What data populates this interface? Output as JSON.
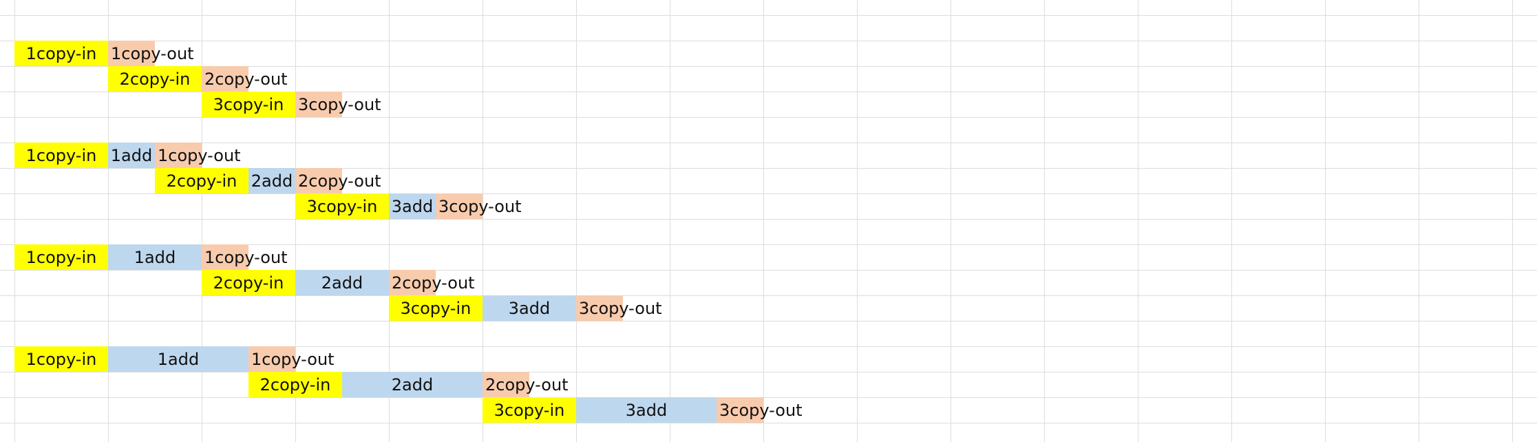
{
  "colors": {
    "copy_in": "#ffff00",
    "add": "#bdd7ee",
    "copy_out": "#f8cbad",
    "gridline": "#dcdcdc"
  },
  "groups": [
    {
      "rows": [
        [
          {
            "label": "1copy-in",
            "kind": "copy_in",
            "start": 0,
            "span": 2
          },
          {
            "label": "1copy-out",
            "kind": "copy_out",
            "start": 2,
            "span": 1
          }
        ],
        [
          {
            "label": "2copy-in",
            "kind": "copy_in",
            "start": 2,
            "span": 2
          },
          {
            "label": "2copy-out",
            "kind": "copy_out",
            "start": 4,
            "span": 1
          }
        ],
        [
          {
            "label": "3copy-in",
            "kind": "copy_in",
            "start": 4,
            "span": 2
          },
          {
            "label": "3copy-out",
            "kind": "copy_out",
            "start": 6,
            "span": 1
          }
        ]
      ]
    },
    {
      "rows": [
        [
          {
            "label": "1copy-in",
            "kind": "copy_in",
            "start": 0,
            "span": 2
          },
          {
            "label": "1add",
            "kind": "add",
            "start": 2,
            "span": 1
          },
          {
            "label": "1copy-out",
            "kind": "copy_out",
            "start": 3,
            "span": 1
          }
        ],
        [
          {
            "label": "2copy-in",
            "kind": "copy_in",
            "start": 3,
            "span": 2
          },
          {
            "label": "2add",
            "kind": "add",
            "start": 5,
            "span": 1
          },
          {
            "label": "2copy-out",
            "kind": "copy_out",
            "start": 6,
            "span": 1
          }
        ],
        [
          {
            "label": "3copy-in",
            "kind": "copy_in",
            "start": 6,
            "span": 2
          },
          {
            "label": "3add",
            "kind": "add",
            "start": 8,
            "span": 1
          },
          {
            "label": "3copy-out",
            "kind": "copy_out",
            "start": 9,
            "span": 1
          }
        ]
      ]
    },
    {
      "rows": [
        [
          {
            "label": "1copy-in",
            "kind": "copy_in",
            "start": 0,
            "span": 2
          },
          {
            "label": "1add",
            "kind": "add",
            "start": 2,
            "span": 2
          },
          {
            "label": "1copy-out",
            "kind": "copy_out",
            "start": 4,
            "span": 1
          }
        ],
        [
          {
            "label": "2copy-in",
            "kind": "copy_in",
            "start": 4,
            "span": 2
          },
          {
            "label": "2add",
            "kind": "add",
            "start": 6,
            "span": 2
          },
          {
            "label": "2copy-out",
            "kind": "copy_out",
            "start": 8,
            "span": 1
          }
        ],
        [
          {
            "label": "3copy-in",
            "kind": "copy_in",
            "start": 8,
            "span": 2
          },
          {
            "label": "3add",
            "kind": "add",
            "start": 10,
            "span": 2
          },
          {
            "label": "3copy-out",
            "kind": "copy_out",
            "start": 12,
            "span": 1
          }
        ]
      ]
    },
    {
      "rows": [
        [
          {
            "label": "1copy-in",
            "kind": "copy_in",
            "start": 0,
            "span": 2
          },
          {
            "label": "1add",
            "kind": "add",
            "start": 2,
            "span": 3
          },
          {
            "label": "1copy-out",
            "kind": "copy_out",
            "start": 5,
            "span": 1
          }
        ],
        [
          {
            "label": "2copy-in",
            "kind": "copy_in",
            "start": 5,
            "span": 2
          },
          {
            "label": "2add",
            "kind": "add",
            "start": 7,
            "span": 3
          },
          {
            "label": "2copy-out",
            "kind": "copy_out",
            "start": 10,
            "span": 1
          }
        ],
        [
          {
            "label": "3copy-in",
            "kind": "copy_in",
            "start": 10,
            "span": 2
          },
          {
            "label": "3add",
            "kind": "add",
            "start": 12,
            "span": 3
          },
          {
            "label": "3copy-out",
            "kind": "copy_out",
            "start": 15,
            "span": 1
          }
        ]
      ]
    }
  ]
}
